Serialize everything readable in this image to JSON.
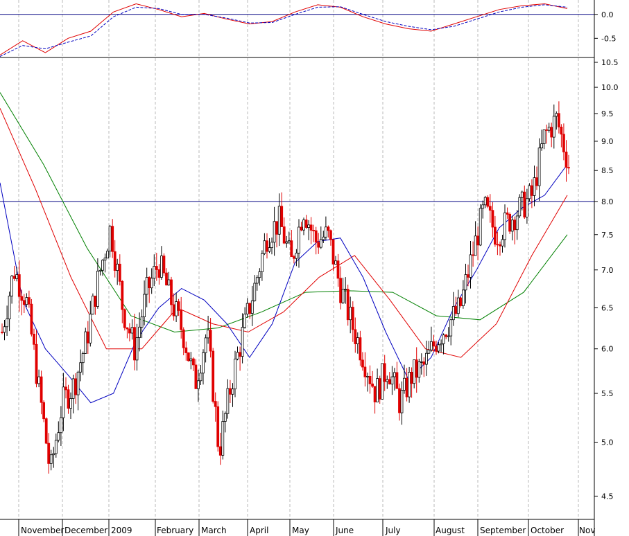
{
  "chart_data": [
    {
      "type": "line",
      "panel": "oscillator",
      "ylim": [
        -0.9,
        0.3
      ],
      "yticks": [
        "0.0",
        "-0.5"
      ],
      "ytick_values": [
        0.0,
        -0.5
      ],
      "reference_line": 0.0,
      "colors": {
        "line": "#e00000",
        "signal": "#0000c0",
        "zero": "#000080"
      },
      "x": [
        0,
        10,
        20,
        30,
        40,
        50,
        60,
        70,
        80,
        90,
        100,
        110,
        120,
        130,
        140,
        150,
        160,
        170,
        180,
        190,
        200,
        210,
        220,
        230,
        240,
        250
      ],
      "series": [
        {
          "style": "solid",
          "values": [
            -0.85,
            -0.55,
            -0.8,
            -0.5,
            -0.35,
            0.05,
            0.22,
            0.1,
            -0.05,
            0.02,
            -0.1,
            -0.2,
            -0.15,
            0.05,
            0.2,
            0.15,
            -0.05,
            -0.2,
            -0.3,
            -0.35,
            -0.2,
            -0.05,
            0.1,
            0.18,
            0.22,
            0.12
          ]
        },
        {
          "style": "dashed",
          "values": [
            -0.88,
            -0.65,
            -0.72,
            -0.58,
            -0.45,
            -0.05,
            0.15,
            0.12,
            0.0,
            0.0,
            -0.08,
            -0.18,
            -0.17,
            0.0,
            0.15,
            0.16,
            0.0,
            -0.15,
            -0.25,
            -0.32,
            -0.25,
            -0.1,
            0.05,
            0.15,
            0.2,
            0.15
          ]
        }
      ]
    },
    {
      "type": "candlestick",
      "panel": "price",
      "scale": "log",
      "ylim": [
        4.3,
        10.6
      ],
      "yticks": [
        "10.5",
        "10.0",
        "9.5",
        "9.0",
        "8.5",
        "8.0",
        "7.5",
        "7.0",
        "6.5",
        "6.0",
        "5.5",
        "5.0",
        "4.5"
      ],
      "ytick_values": [
        10.5,
        10.0,
        9.5,
        9.0,
        8.5,
        8.0,
        7.5,
        7.0,
        6.5,
        6.0,
        5.5,
        5.0,
        4.5
      ],
      "reference_line": 8.0,
      "colors": {
        "up": "#000000",
        "down": "#e00000",
        "ma_short": "#0000c0",
        "ma_mid": "#e00000",
        "ma_long": "#008000",
        "ref": "#000080"
      },
      "x_labels": [
        "November",
        "December",
        "2009",
        "February",
        "March",
        "April",
        "May",
        "June",
        "July",
        "August",
        "September",
        "October",
        "Nov"
      ],
      "close": [
        6.2,
        7.0,
        6.6,
        5.6,
        4.7,
        5.4,
        5.6,
        6.1,
        6.9,
        7.6,
        6.5,
        6.0,
        6.7,
        7.1,
        6.6,
        6.2,
        5.6,
        6.2,
        4.9,
        5.6,
        6.2,
        6.8,
        7.5,
        7.7,
        7.1,
        7.9,
        7.4,
        7.5,
        6.8,
        6.3,
        5.9,
        5.5,
        5.8,
        5.4,
        5.7,
        5.8,
        6.1,
        6.3,
        6.5,
        7.2,
        7.9,
        7.5,
        7.7,
        7.9,
        8.1,
        9.1,
        9.4,
        8.6
      ],
      "ma_short": [
        8.3,
        6.6,
        6.0,
        5.7,
        5.4,
        5.5,
        6.1,
        6.5,
        6.75,
        6.6,
        6.3,
        5.9,
        6.3,
        7.1,
        7.4,
        7.45,
        6.9,
        6.2,
        5.65,
        5.9,
        6.5,
        7.0,
        7.6,
        7.9,
        8.1,
        8.6
      ],
      "ma_mid": [
        9.6,
        8.2,
        6.9,
        6.0,
        6.0,
        6.5,
        6.3,
        6.2,
        6.45,
        6.9,
        7.2,
        6.6,
        6.0,
        5.9,
        6.3,
        7.2,
        8.1
      ],
      "ma_long": [
        9.9,
        8.6,
        7.3,
        6.4,
        6.2,
        6.25,
        6.45,
        6.7,
        6.72,
        6.7,
        6.4,
        6.35,
        6.7,
        7.5
      ]
    }
  ]
}
